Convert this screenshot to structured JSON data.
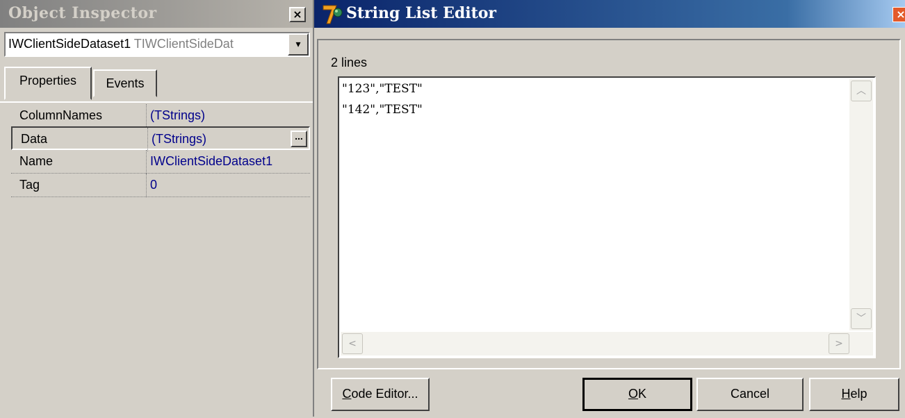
{
  "object_inspector": {
    "title": "Object Inspector",
    "close_glyph": "×",
    "combo": {
      "component_name": "IWClientSideDataset1",
      "component_class": "TIWClientSideDat",
      "dropdown_glyph": "▾"
    },
    "tabs": [
      {
        "label": "Properties"
      },
      {
        "label": "Events"
      }
    ],
    "properties": [
      {
        "name": "ColumnNames",
        "value": "(TStrings)"
      },
      {
        "name": "Data",
        "value": "(TStrings)",
        "selected": true
      },
      {
        "name": "Name",
        "value": "IWClientSideDataset1"
      },
      {
        "name": "Tag",
        "value": "0"
      }
    ],
    "ellipsis_glyph": "..."
  },
  "string_list_editor": {
    "title": "String List Editor",
    "close_glyph": "×",
    "line_count_label": "2 lines",
    "lines": [
      "\"123\",\"TEST\"",
      "\"142\",\"TEST\""
    ],
    "scroll_up_glyph": "︿",
    "scroll_down_glyph": "﹀",
    "scroll_left_glyph": "<",
    "scroll_right_glyph": ">",
    "buttons": {
      "code_editor": {
        "mnemonic": "C",
        "rest": "ode Editor..."
      },
      "ok": {
        "mnemonic": "O",
        "rest": "K"
      },
      "cancel": {
        "label": "Cancel"
      },
      "help": {
        "mnemonic": "H",
        "rest": "elp"
      }
    },
    "colors": {
      "title_bar_start": "#0a246a",
      "title_bar_end": "#a6caf0",
      "property_value": "#00008b"
    }
  }
}
